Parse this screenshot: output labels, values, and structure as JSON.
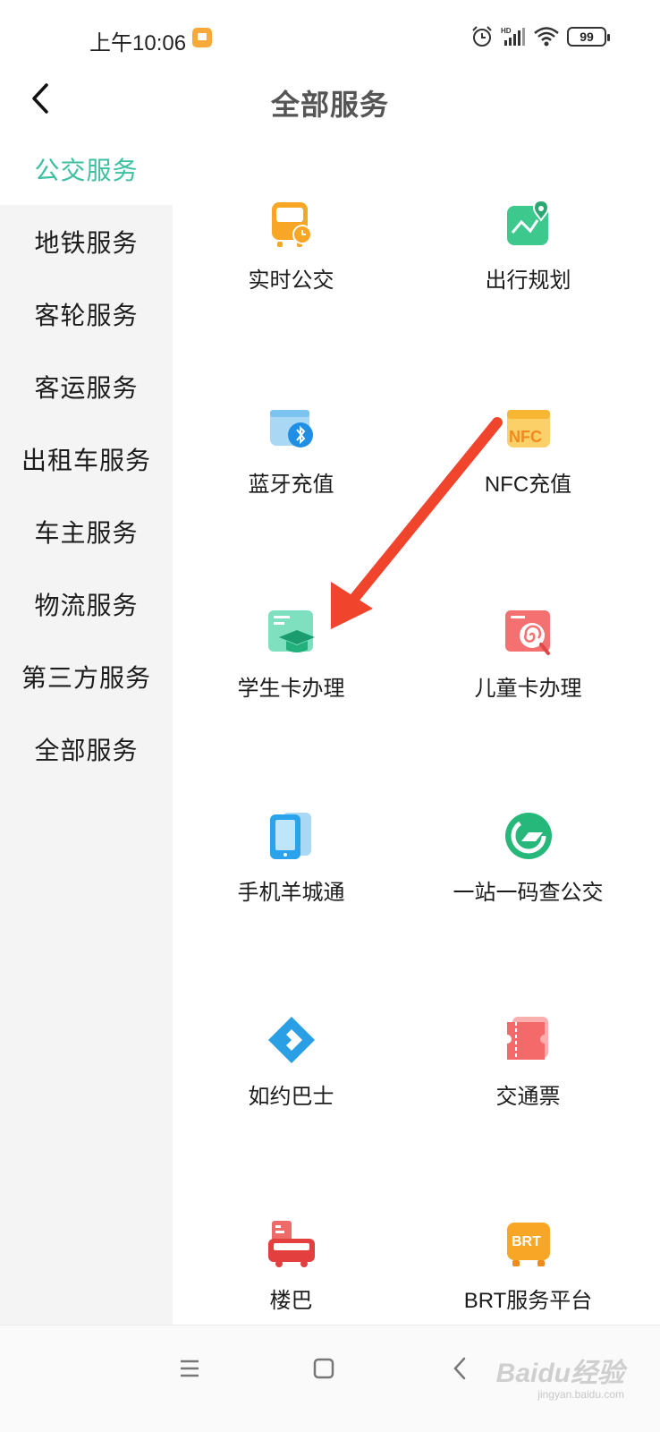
{
  "status_bar": {
    "time": "上午10:06",
    "signal_label": "HD",
    "battery": "99"
  },
  "header": {
    "title": "全部服务",
    "back_icon": "chevron-left-icon"
  },
  "sidebar": {
    "items": [
      {
        "label": "公交服务",
        "active": true
      },
      {
        "label": "地铁服务",
        "active": false
      },
      {
        "label": "客轮服务",
        "active": false
      },
      {
        "label": "客运服务",
        "active": false
      },
      {
        "label": "出租车服务",
        "active": false
      },
      {
        "label": "车主服务",
        "active": false
      },
      {
        "label": "物流服务",
        "active": false
      },
      {
        "label": "第三方服务",
        "active": false
      },
      {
        "label": "全部服务",
        "active": false
      }
    ]
  },
  "services": [
    {
      "label": "实时公交",
      "icon": "bus-clock-icon"
    },
    {
      "label": "出行规划",
      "icon": "map-route-icon"
    },
    {
      "label": "蓝牙充值",
      "icon": "bluetooth-card-icon"
    },
    {
      "label": "NFC充值",
      "icon": "nfc-wallet-icon"
    },
    {
      "label": "学生卡办理",
      "icon": "student-card-icon"
    },
    {
      "label": "儿童卡办理",
      "icon": "child-card-icon"
    },
    {
      "label": "手机羊城通",
      "icon": "phone-card-icon"
    },
    {
      "label": "一站一码查公交",
      "icon": "station-code-icon"
    },
    {
      "label": "如约巴士",
      "icon": "diamond-bus-icon"
    },
    {
      "label": "交通票",
      "icon": "ticket-icon"
    },
    {
      "label": "楼巴",
      "icon": "building-bus-icon"
    },
    {
      "label": "BRT服务平台",
      "icon": "brt-bus-icon"
    }
  ],
  "nav": {
    "menu_icon": "menu-icon",
    "home_icon": "home-square-icon",
    "back_icon": "back-triangle-icon"
  },
  "watermark": {
    "text": "Baidu经验",
    "sub": "jingyan.baidu.com"
  },
  "colors": {
    "accent": "#3cc0a0",
    "sidebar_bg": "#f4f4f4",
    "arrow": "#f0452c"
  }
}
